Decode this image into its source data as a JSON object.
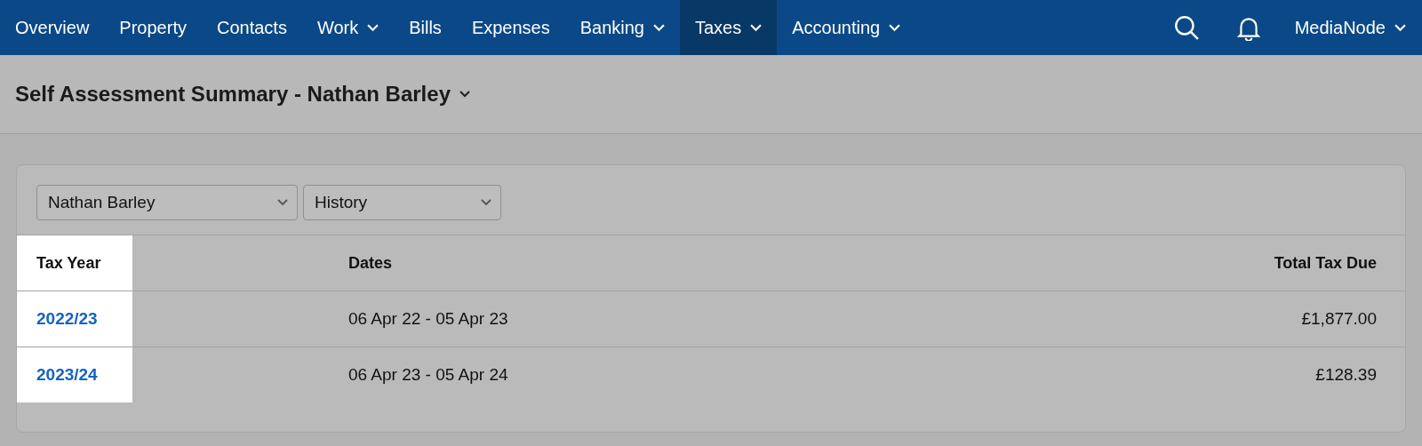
{
  "nav": {
    "items": [
      {
        "label": "Overview",
        "dropdown": false,
        "selected": false
      },
      {
        "label": "Property",
        "dropdown": false,
        "selected": false
      },
      {
        "label": "Contacts",
        "dropdown": false,
        "selected": false
      },
      {
        "label": "Work",
        "dropdown": true,
        "selected": false
      },
      {
        "label": "Bills",
        "dropdown": false,
        "selected": false
      },
      {
        "label": "Expenses",
        "dropdown": false,
        "selected": false
      },
      {
        "label": "Banking",
        "dropdown": true,
        "selected": false
      },
      {
        "label": "Taxes",
        "dropdown": true,
        "selected": true
      },
      {
        "label": "Accounting",
        "dropdown": true,
        "selected": false
      }
    ],
    "account": "MediaNode"
  },
  "page_title": "Self Assessment Summary - Nathan Barley",
  "filters": [
    {
      "value": "Nathan Barley"
    },
    {
      "value": "History"
    }
  ],
  "table": {
    "columns": [
      {
        "label": "Tax Year",
        "highlighted": true
      },
      {
        "label": "Dates",
        "highlighted": false
      },
      {
        "label": "Total Tax Due",
        "highlighted": false
      }
    ],
    "rows": [
      {
        "cells": [
          "2022/23",
          "06 Apr 22 - 05 Apr 23",
          "£1,877.00"
        ]
      },
      {
        "cells": [
          "2023/24",
          "06 Apr 23 - 05 Apr 24",
          "£128.39"
        ]
      }
    ]
  }
}
